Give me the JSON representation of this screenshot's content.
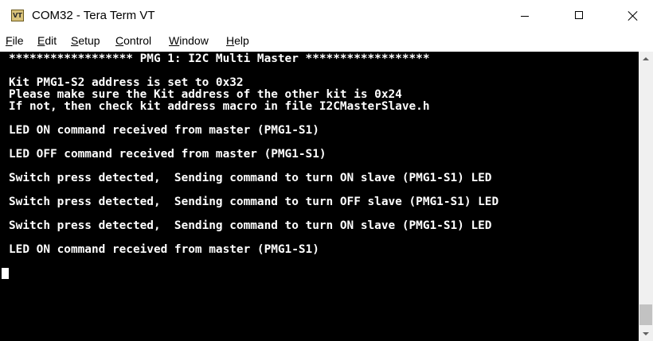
{
  "window": {
    "title": "COM32 - Tera Term VT",
    "icon_text": "VT"
  },
  "menu": {
    "items": [
      {
        "accel": "F",
        "rest": "ile"
      },
      {
        "accel": "E",
        "rest": "dit"
      },
      {
        "accel": "S",
        "rest": "etup"
      },
      {
        "accel": "C",
        "rest": "ontrol"
      },
      {
        "accel": "W",
        "rest": "indow"
      },
      {
        "accel": "H",
        "rest": "elp"
      }
    ]
  },
  "terminal": {
    "lines": [
      "****************** PMG 1: I2C Multi Master ******************",
      "Kit PMG1-S2 address is set to 0x32",
      "Please make sure the Kit address of the other kit is 0x24",
      "If not, then check kit address macro in file I2CMasterSlave.h",
      "LED ON command received from master (PMG1-S1)",
      "LED OFF command received from master (PMG1-S1)",
      "Switch press detected,  Sending command to turn ON slave (PMG1-S1) LED",
      "Switch press detected,  Sending command to turn OFF slave (PMG1-S1) LED",
      "Switch press detected,  Sending command to turn ON slave (PMG1-S1) LED",
      "LED ON command received from master (PMG1-S1)"
    ]
  },
  "colors": {
    "terminal_bg": "#000000",
    "terminal_fg": "#ffffff"
  }
}
